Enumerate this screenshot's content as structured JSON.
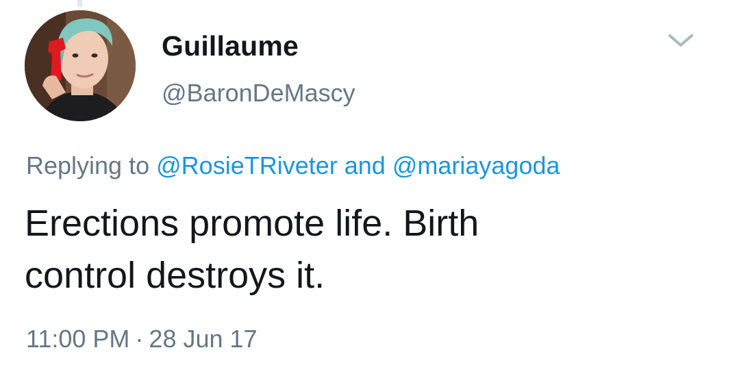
{
  "author": {
    "display_name": "Guillaume",
    "handle": "@BaronDeMascy",
    "avatar_icon": "profile-photo"
  },
  "menu_icon": "chevron-down-icon",
  "reply": {
    "prefix": "Replying to",
    "mention_1": "@RosieTRiveter",
    "conjunction": "and",
    "mention_2": "@mariayagoda"
  },
  "tweet": {
    "line_1": "Erections promote life. Birth",
    "line_2": "control destroys it."
  },
  "meta": {
    "time": "11:00 PM",
    "separator": "·",
    "date": "28 Jun 17"
  },
  "colors": {
    "text": "#14171a",
    "secondary": "#657786",
    "link": "#1b95e0",
    "thread_line": "#e1e8ed"
  }
}
